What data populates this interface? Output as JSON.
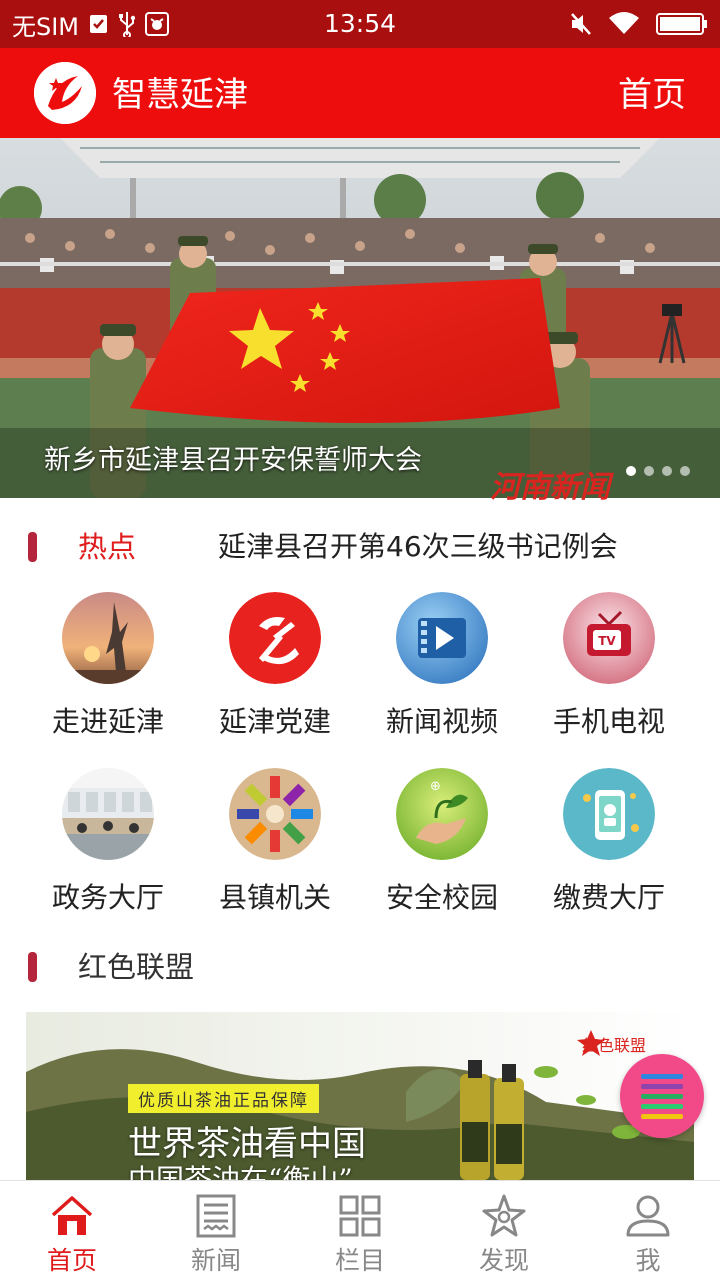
{
  "status_bar": {
    "carrier": "无SIM",
    "time": "13:54",
    "left_icons": [
      "checkbox-icon",
      "usb-icon",
      "debug-icon"
    ],
    "right_icons": [
      "mute-icon",
      "wifi-icon",
      "battery-icon"
    ]
  },
  "header": {
    "title": "智慧延津",
    "home_link": "首页",
    "logo_icon": "app-logo-icon"
  },
  "banner": {
    "caption": "新乡市延津县召开安保誓师大会",
    "watermark": "河南新闻",
    "slide_count": 4,
    "active_slide": 0
  },
  "hot": {
    "label": "热点",
    "headline": "延津县召开第46次三级书记例会"
  },
  "grid": [
    {
      "label": "走进延津",
      "icon": "sculpture-icon"
    },
    {
      "label": "延津党建",
      "icon": "party-emblem-icon"
    },
    {
      "label": "新闻视频",
      "icon": "video-icon"
    },
    {
      "label": "手机电视",
      "icon": "tv-icon"
    },
    {
      "label": "政务大厅",
      "icon": "office-hall-icon"
    },
    {
      "label": "县镇机关",
      "icon": "institutions-icon"
    },
    {
      "label": "安全校园",
      "icon": "safe-campus-icon"
    },
    {
      "label": "缴费大厅",
      "icon": "payment-icon"
    }
  ],
  "section": {
    "label": "红色联盟"
  },
  "ad": {
    "tagline": "优质山茶油正品保障",
    "title": "世界茶油看中国",
    "subtitle": "中国茶油在“衡山”",
    "brand": "红色联盟"
  },
  "bottom_nav": [
    {
      "label": "首页",
      "icon": "home-icon",
      "active": true
    },
    {
      "label": "新闻",
      "icon": "news-icon",
      "active": false
    },
    {
      "label": "栏目",
      "icon": "columns-icon",
      "active": false
    },
    {
      "label": "发现",
      "icon": "discover-icon",
      "active": false
    },
    {
      "label": "我",
      "icon": "profile-icon",
      "active": false
    }
  ],
  "colors": {
    "status_bar": "#a90f0f",
    "header": "#ee0d0d",
    "accent_red": "#e01b1b",
    "section_marker": "#b4243a",
    "fab": "#f24a89"
  }
}
